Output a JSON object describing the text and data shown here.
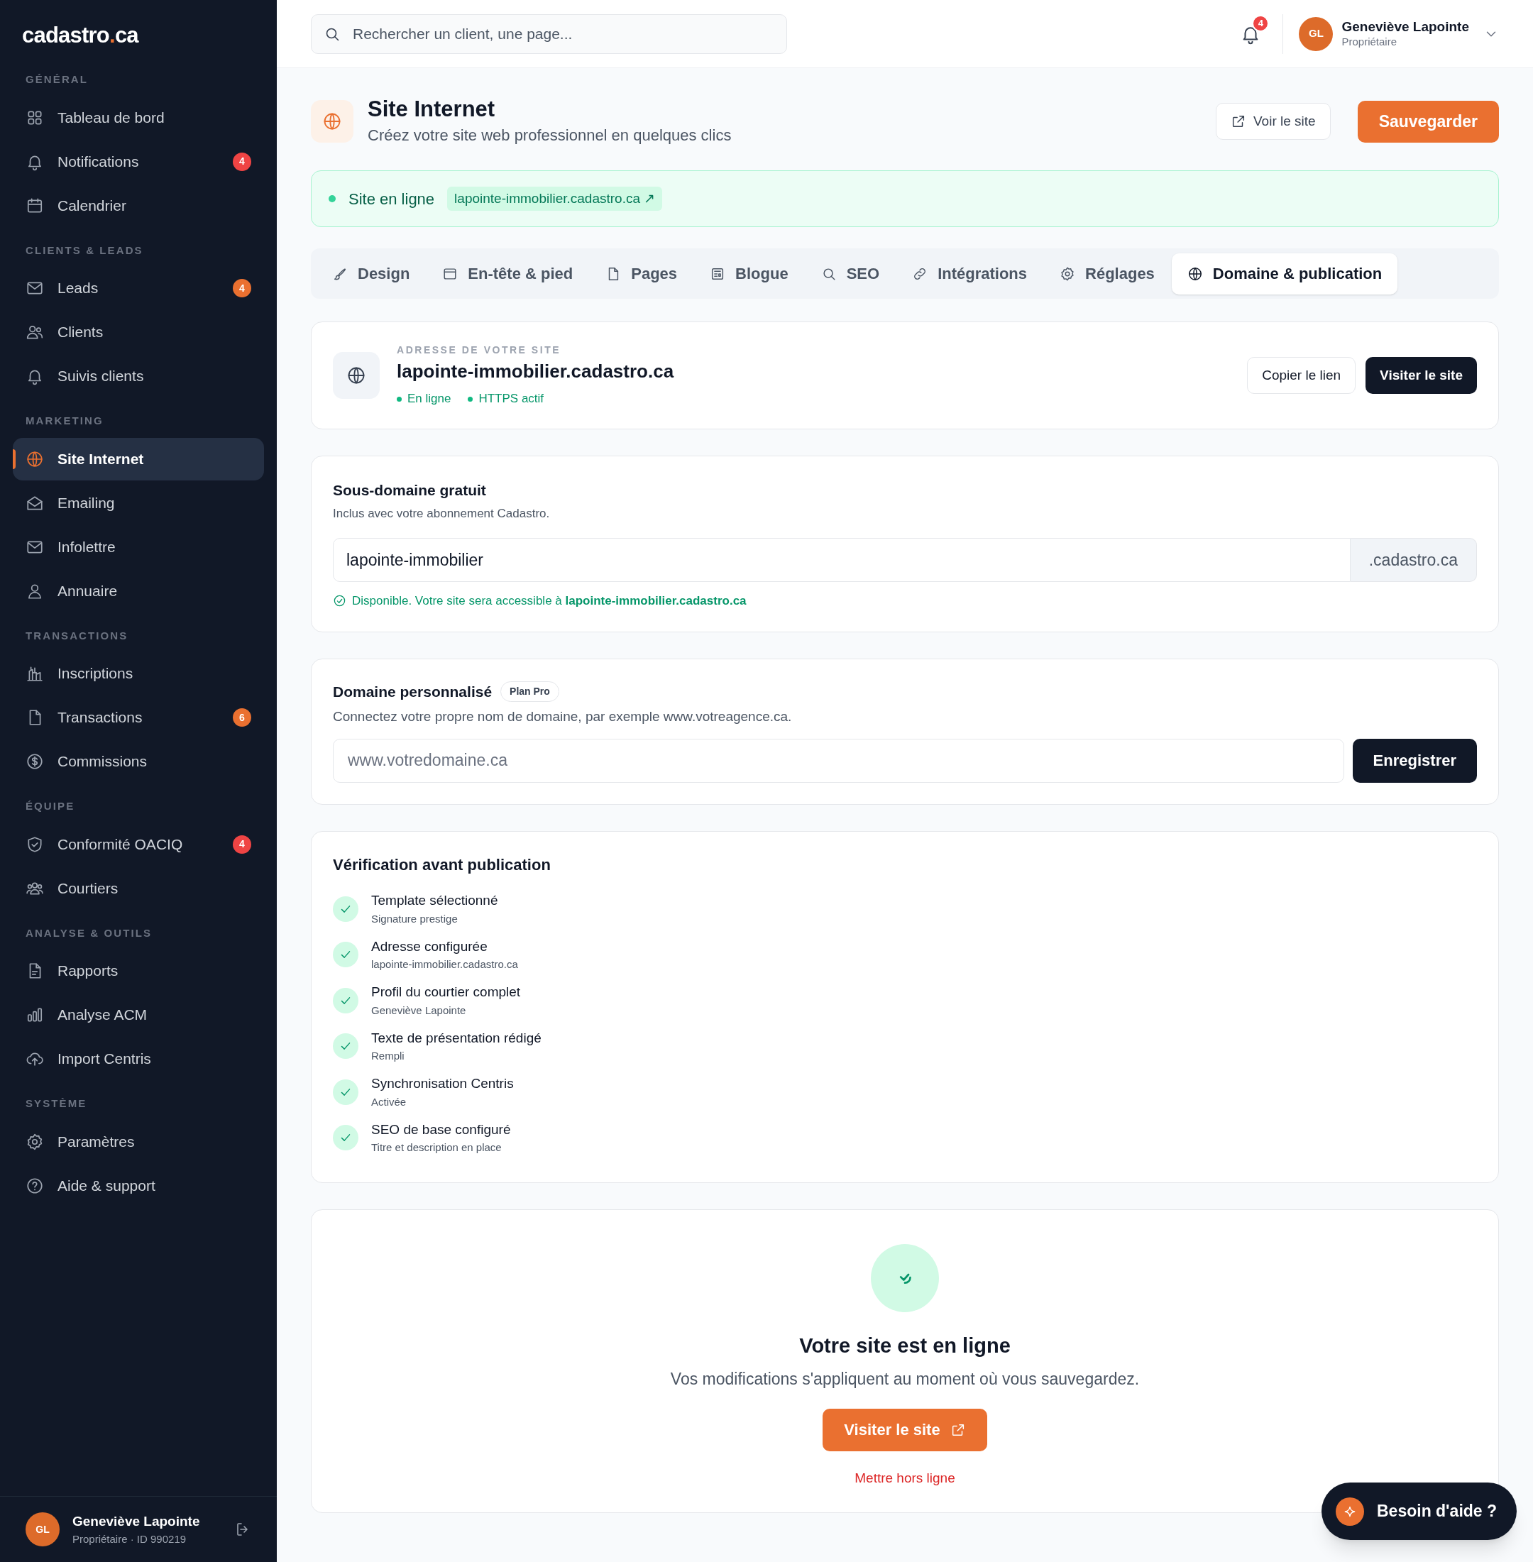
{
  "sidebar": {
    "logo": {
      "parts": [
        "cadastro",
        ".",
        "ca"
      ]
    },
    "sections": [
      {
        "title": "GÉNÉRAL",
        "items": [
          {
            "label": "Tableau de bord",
            "selected": false
          },
          {
            "label": "Notifications",
            "selected": false,
            "badge": {
              "text": "4",
              "color": "#ef4444"
            }
          },
          {
            "label": "Calendrier",
            "selected": false
          }
        ]
      },
      {
        "title": "CLIENTS & LEADS",
        "items": [
          {
            "label": "Leads",
            "selected": false,
            "badge": {
              "text": "4",
              "color": "#ea7030"
            }
          },
          {
            "label": "Clients",
            "selected": false
          },
          {
            "label": "Suivis clients",
            "selected": false
          }
        ]
      },
      {
        "title": "MARKETING",
        "items": [
          {
            "label": "Site Internet",
            "selected": true
          },
          {
            "label": "Emailing",
            "selected": false
          },
          {
            "label": "Infolettre",
            "selected": false
          },
          {
            "label": "Annuaire",
            "selected": false
          }
        ]
      },
      {
        "title": "TRANSACTIONS",
        "items": [
          {
            "label": "Inscriptions",
            "selected": false
          },
          {
            "label": "Transactions",
            "selected": false,
            "badge": {
              "text": "6",
              "color": "#ea7030"
            }
          },
          {
            "label": "Commissions",
            "selected": false
          }
        ]
      },
      {
        "title": "ÉQUIPE",
        "items": [
          {
            "label": "Conformité OACIQ",
            "selected": false,
            "badge": {
              "text": "4",
              "color": "#ef4444"
            }
          },
          {
            "label": "Courtiers",
            "selected": false
          }
        ]
      },
      {
        "title": "ANALYSE & OUTILS",
        "items": [
          {
            "label": "Rapports",
            "selected": false
          },
          {
            "label": "Analyse ACM",
            "selected": false
          },
          {
            "label": "Import Centris",
            "selected": false
          }
        ]
      },
      {
        "title": "SYSTÈME",
        "items": [
          {
            "label": "Paramètres",
            "selected": false
          },
          {
            "label": "Aide & support",
            "selected": false
          }
        ]
      }
    ],
    "user": {
      "initials": "GL",
      "name": "Geneviève Lapointe",
      "meta": "Propriétaire · ID 990219"
    }
  },
  "topbar": {
    "search": {
      "placeholder": "Rechercher un client, une page..."
    },
    "notifications_badge": "4",
    "user": {
      "initials": "GL",
      "name": "Geneviève Lapointe",
      "role": "Propriétaire"
    }
  },
  "page": {
    "title": "Site Internet",
    "subtitle": "Créez votre site web professionnel en quelques clics",
    "view_button": "Voir le site",
    "save_button": "Sauvegarder"
  },
  "status_banner": {
    "label": "Site en ligne",
    "link": "lapointe-immobilier.cadastro.ca ↗"
  },
  "tabs": [
    {
      "label": "Design",
      "selected": false
    },
    {
      "label": "En-tête & pied",
      "selected": false
    },
    {
      "label": "Pages",
      "selected": false
    },
    {
      "label": "Blogue",
      "selected": false
    },
    {
      "label": "SEO",
      "selected": false
    },
    {
      "label": "Intégrations",
      "selected": false
    },
    {
      "label": "Réglages",
      "selected": false
    },
    {
      "label": "Domaine & publication",
      "selected": true
    }
  ],
  "address_card": {
    "eyebrow": "ADRESSE DE VOTRE SITE",
    "domain": "lapointe-immobilier.cadastro.ca",
    "statuses": [
      "En ligne",
      "HTTPS actif"
    ],
    "copy_button": "Copier le lien",
    "visit_button": "Visiter le site"
  },
  "subdomain_card": {
    "title": "Sous-domaine gratuit",
    "description": "Inclus avec votre abonnement Cadastro.",
    "value": "lapointe-immobilier",
    "suffix": ".cadastro.ca",
    "message": "Disponible. Votre site sera accessible à **lapointe-immobilier.cadastro.ca**"
  },
  "custom_domain_card": {
    "title": "Domaine personnalisé",
    "badge": "Plan Pro",
    "description": "Connectez votre propre nom de domaine, par exemple www.votreagence.ca.",
    "placeholder": "www.votredomaine.ca",
    "button": "Enregistrer"
  },
  "checklist": {
    "title": "Vérification avant publication",
    "items": [
      {
        "title": "Template sélectionné",
        "detail": "Signature prestige",
        "checked": true
      },
      {
        "title": "Adresse configurée",
        "detail": "lapointe-immobilier.cadastro.ca",
        "checked": true
      },
      {
        "title": "Profil du courtier complet",
        "detail": "Geneviève Lapointe",
        "checked": true
      },
      {
        "title": "Texte de présentation rédigé",
        "detail": "Rempli",
        "checked": true
      },
      {
        "title": "Synchronisation Centris",
        "detail": "Activée",
        "checked": true
      },
      {
        "title": "SEO de base configuré",
        "detail": "Titre et description en place",
        "checked": true
      }
    ]
  },
  "publish_card": {
    "title": "Votre site est en ligne",
    "description": "Vos modifications s'appliquent au moment où vous sauvegardez.",
    "button": "Visiter le site",
    "link": "Mettre hors ligne"
  },
  "help_button": "Besoin d'aide ?"
}
